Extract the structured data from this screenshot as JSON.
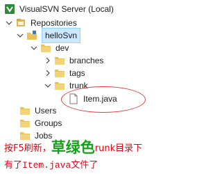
{
  "tree": {
    "root": {
      "label": "VisualSVN Server (Local)",
      "icon": "server-icon"
    },
    "repositories": {
      "label": "Repositories",
      "icon": "repository-icon"
    },
    "repo": {
      "label": "helloSvn",
      "icon": "repo-folder-icon"
    },
    "dev": {
      "label": "dev",
      "icon": "folder-icon"
    },
    "branches": {
      "label": "branches",
      "icon": "folder-icon"
    },
    "tags": {
      "label": "tags",
      "icon": "folder-icon"
    },
    "trunk": {
      "label": "trunk",
      "icon": "folder-icon"
    },
    "file": {
      "label": "Item.java",
      "icon": "file-icon"
    },
    "users": {
      "label": "Users",
      "icon": "folder-icon"
    },
    "groups": {
      "label": "Groups",
      "icon": "folder-icon"
    },
    "jobs": {
      "label": "Jobs",
      "icon": "folder-icon"
    }
  },
  "annotation": {
    "part1": "按F5刷新，",
    "highlight": "草绿色",
    "part2": "runk目录下有了",
    "mono": "Item.java",
    "part3": "文件了"
  },
  "colors": {
    "annotation_text": "#e60012",
    "highlight_text": "#14a11a",
    "ellipse": "#e6393b",
    "selection": "#cce8ff",
    "folder": "#e8c25c"
  }
}
